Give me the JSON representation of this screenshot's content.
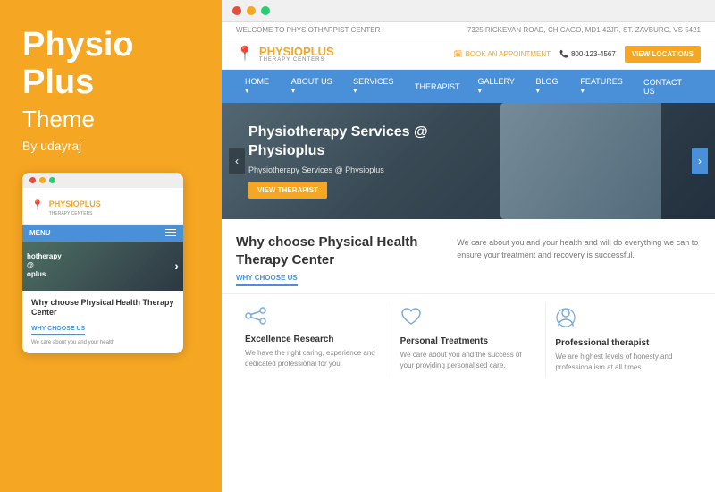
{
  "left": {
    "title_line1": "Physio",
    "title_line2": "Plus",
    "theme_label": "Theme",
    "by_label": "By udayraj"
  },
  "mobile": {
    "logo_text": "PHYSIOPLUS",
    "logo_sub": "THERAPY CENTERS",
    "menu_label": "MENU",
    "hero_text_line1": "hotherapy",
    "hero_text_line2": "@ ",
    "hero_text_line3": "oplus",
    "section_title": "Why choose Physical Health Therapy Center",
    "why_label": "WHY CHOOSE US",
    "body_text": "We care about you and your health"
  },
  "browser": {
    "dots": [
      "red",
      "yellow",
      "green"
    ]
  },
  "site": {
    "topbar_left": "WELCOME TO PHYSIOTHARPIST CENTER",
    "topbar_right": "7325 RICKEVAN ROAD, CHICAGO, MD1 42JR, ST. ZAVBURG, VS 5421",
    "logo_name": "PHYSIOPLUS",
    "logo_sub": "THERAPY CENTERS",
    "book_appt": "BOOK AN APPOINTMENT",
    "phone": "800-123-4567",
    "view_locations": "VIEW LOCATIONS",
    "nav_items": [
      {
        "label": "HOME ▾"
      },
      {
        "label": "ABOUT US ▾"
      },
      {
        "label": "SERVICES ▾"
      },
      {
        "label": "THERAPIST"
      },
      {
        "label": "GALLERY ▾"
      },
      {
        "label": "BLOG ▾"
      },
      {
        "label": "FEATURES ▾"
      },
      {
        "label": "CONTACT US"
      }
    ],
    "hero_title": "Physiotherapy Services @ Physioplus",
    "hero_subtitle": "Physiotherapy Services @ Physioplus",
    "hero_btn": "VIEW THERAPIST",
    "why_title": "Why choose Physical Health Therapy Center",
    "why_label": "WHY CHOOSE US",
    "why_desc": "We care about you and your health and will do everything we can to ensure your treatment and recovery is successful.",
    "features": [
      {
        "icon": "share",
        "title": "Excellence Research",
        "desc": "We have the right caring, experience and dedicated professional for you."
      },
      {
        "icon": "heart",
        "title": "Personal Treatments",
        "desc": "We care about you and the success of your providing personalised care."
      },
      {
        "icon": "person",
        "title": "Professional therapist",
        "desc": "We are highest levels of honesty and professionalism at all times."
      }
    ]
  }
}
